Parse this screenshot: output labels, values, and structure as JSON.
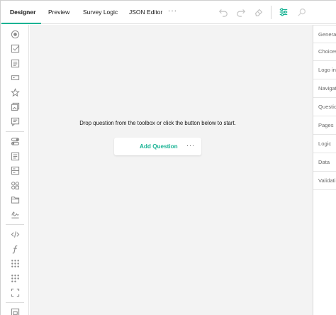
{
  "tabs": [
    {
      "label": "Designer",
      "active": true
    },
    {
      "label": "Preview",
      "active": false
    },
    {
      "label": "Survey Logic",
      "active": false
    },
    {
      "label": "JSON Editor",
      "active": false
    }
  ],
  "tab_more": "···",
  "toolbar_icons": [
    "undo-icon",
    "redo-icon",
    "eraser-icon",
    "settings-sliders-icon",
    "search-icon"
  ],
  "toolbox_icons": [
    "radiogroup-icon",
    "checkbox-icon",
    "dropdown-icon",
    "text-input-icon",
    "rating-star-icon",
    "image-picker-icon",
    "comment-icon",
    "boolean-icon",
    "html-icon",
    "multiple-text-icon",
    "ranking-icon",
    "file-upload-icon",
    "signature-icon",
    "code-icon",
    "expression-icon",
    "matrix-icon",
    "matrix-dynamic-icon",
    "expand-icon",
    "panel-icon"
  ],
  "surface": {
    "empty_message": "Drop question from the toolbox or click the button below to start.",
    "add_question_label": "Add Question",
    "more_label": "···"
  },
  "property_panel": [
    "Genera",
    "Choices",
    "Logo in",
    "Navigat",
    "Questio",
    "Pages",
    "Logic",
    "Data",
    "Validati"
  ],
  "colors": {
    "accent": "#19b394",
    "surface": "#f3f3f3"
  }
}
